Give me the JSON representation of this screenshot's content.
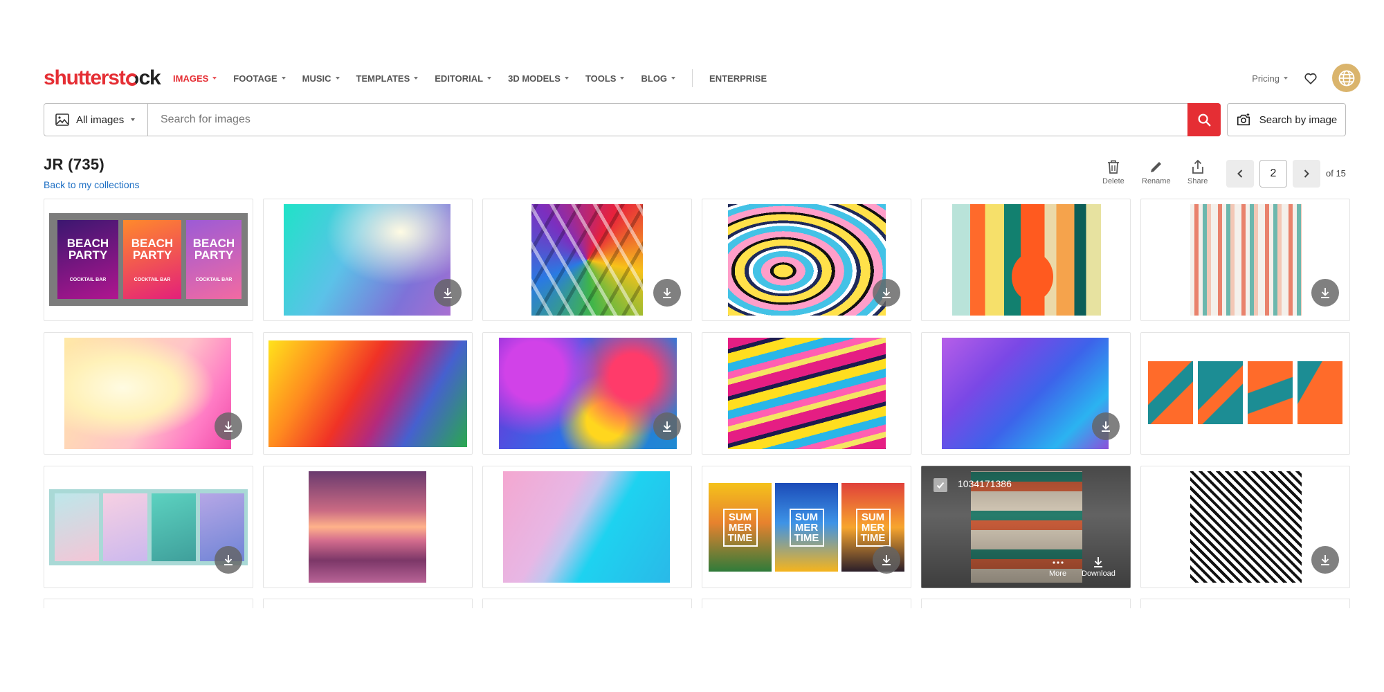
{
  "brand": {
    "logo_head": "shutterst",
    "logo_tail": "ck"
  },
  "nav": {
    "items": [
      "IMAGES",
      "FOOTAGE",
      "MUSIC",
      "TEMPLATES",
      "EDITORIAL",
      "3D MODELS",
      "TOOLS",
      "BLOG"
    ],
    "enterprise": "ENTERPRISE",
    "pricing": "Pricing"
  },
  "search": {
    "type_label": "All images",
    "placeholder": "Search for images",
    "by_image_label": "Search by image"
  },
  "collection": {
    "title": "JR",
    "count": "(735)",
    "back_link": "Back to my collections"
  },
  "toolbar": {
    "delete": "Delete",
    "rename": "Rename",
    "share": "Share"
  },
  "pagination": {
    "current": "2",
    "of_label": "of 15"
  },
  "hover_card": {
    "image_id": "1034171386",
    "more_label": "More",
    "download_label": "Download"
  },
  "posters": {
    "beach": [
      "BEACH PARTY",
      "BEACH PARTY",
      "BEACH PARTY"
    ],
    "cocktail": "COCKTAIL BAR",
    "summer": [
      "SUM MER TIME",
      "SUM MER TIME",
      "SUM MER TIME"
    ]
  },
  "colors": {
    "brand_red": "#e52e34",
    "link_blue": "#1d6fc4",
    "globe": "#dab46c"
  },
  "icons": [
    "image-icon",
    "search-icon",
    "camera-search-icon",
    "heart-icon",
    "globe-icon",
    "trash-icon",
    "pencil-icon",
    "share-icon",
    "chevron-left-icon",
    "chevron-right-icon",
    "download-icon",
    "check-icon",
    "more-icon"
  ]
}
